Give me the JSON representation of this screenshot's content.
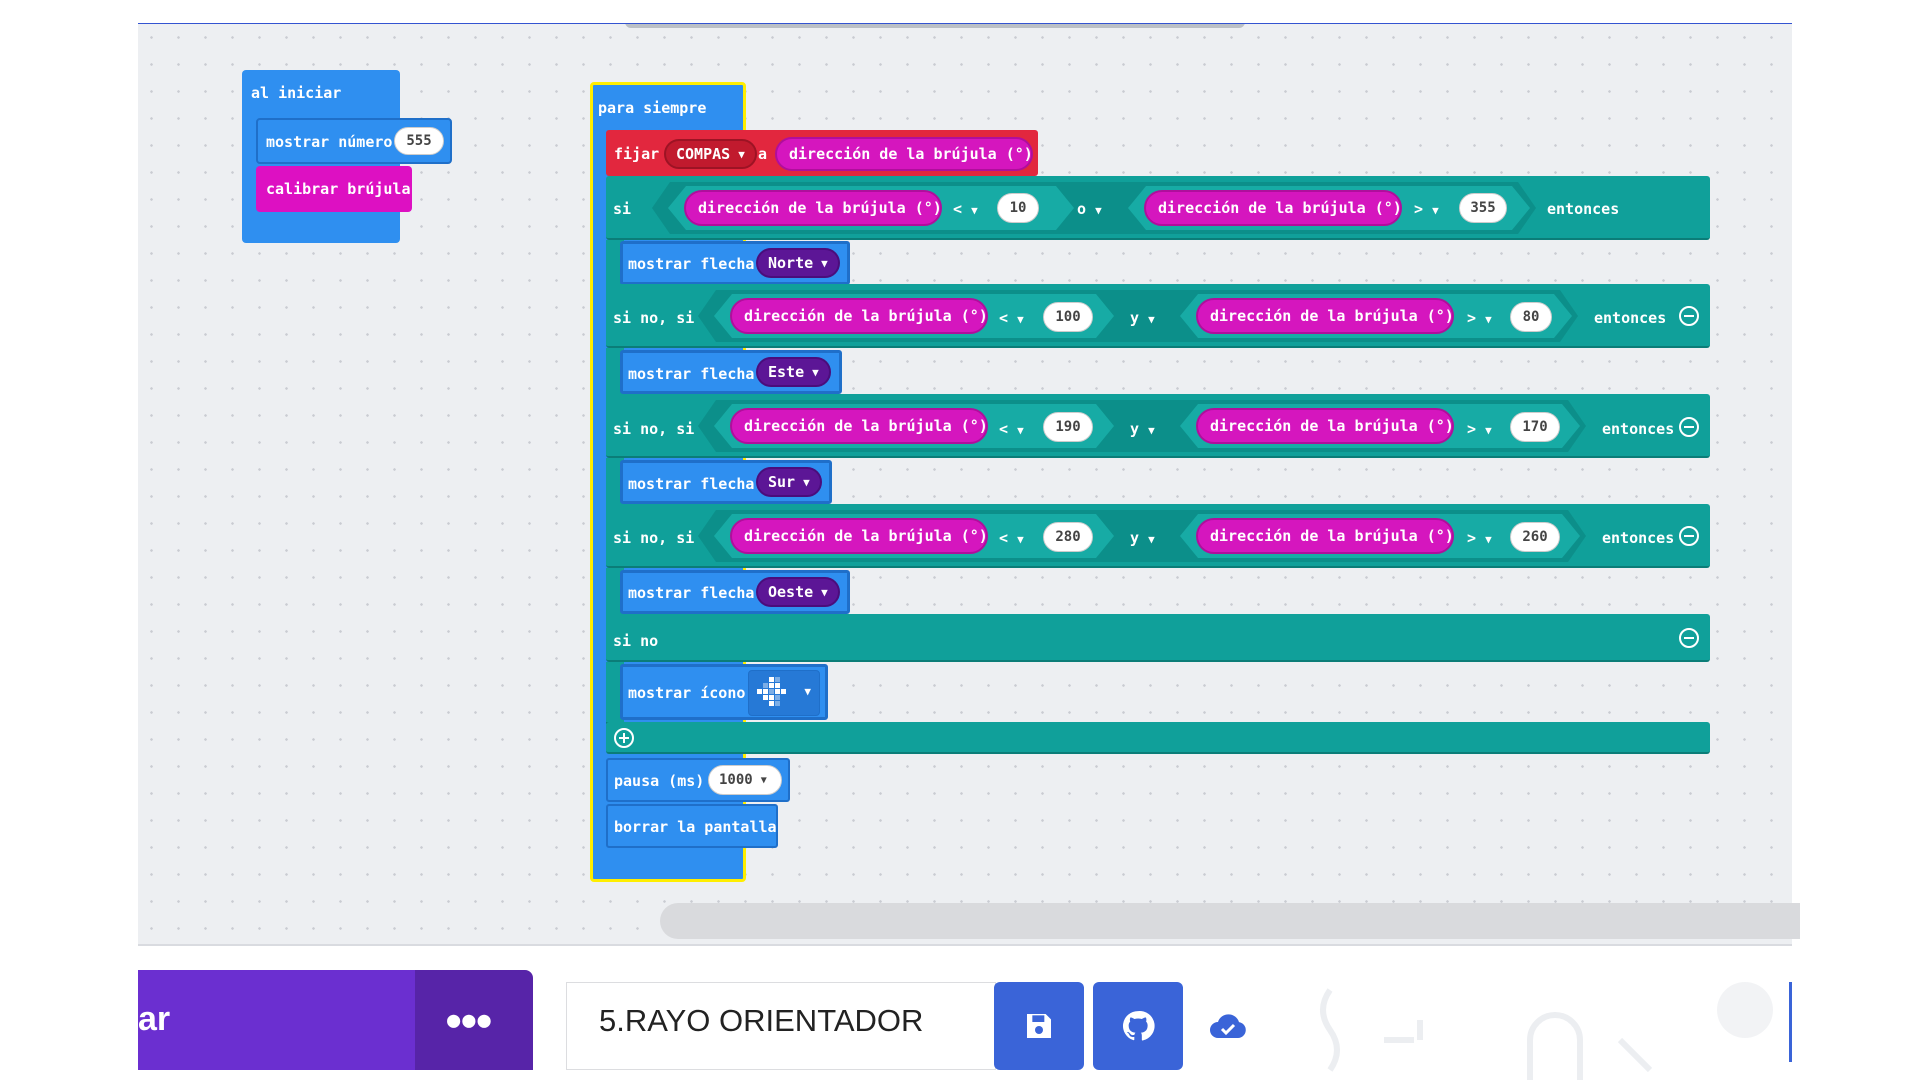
{
  "blocks": {
    "on_start": {
      "hat": "al iniciar",
      "show_number": "mostrar número",
      "number_value": "555",
      "calibrate": "calibrar brújula"
    },
    "forever": {
      "hat": "para siempre",
      "set": "fijar",
      "variable": "COMPAS",
      "to": "a",
      "compass_heading": "dirección de la brújula (°)",
      "if": "si",
      "else_if": "si no, si",
      "else": "si no",
      "then": "entonces",
      "or": "o",
      "and": "y",
      "lt": "<",
      "gt": ">",
      "show_arrow": "mostrar flecha",
      "show_icon": "mostrar ícono",
      "pause": "pausa (ms)",
      "pause_value": "1000",
      "clear": "borrar la pantalla",
      "conditions": [
        {
          "left_value": "10",
          "joiner": "o",
          "right_value": "355",
          "arrow": "Norte"
        },
        {
          "left_value": "100",
          "joiner": "y",
          "right_value": "80",
          "arrow": "Este"
        },
        {
          "left_value": "190",
          "joiner": "y",
          "right_value": "170",
          "arrow": "Sur"
        },
        {
          "left_value": "280",
          "joiner": "y",
          "right_value": "260",
          "arrow": "Oeste"
        }
      ]
    }
  },
  "footer": {
    "download_label": "ar",
    "more_label": "●●●",
    "project_name": "5.RAYO ORIENTADOR",
    "icons": [
      "save-icon",
      "github-icon",
      "cloud-check-icon"
    ]
  },
  "colors": {
    "loops_blue": "#2f8ff0",
    "logic_teal": "#10a09a",
    "variable_red": "#e2273e",
    "input_magenta": "#d516be",
    "accent_purple": "#6b2fd0",
    "save_blue": "#3a64d8"
  }
}
